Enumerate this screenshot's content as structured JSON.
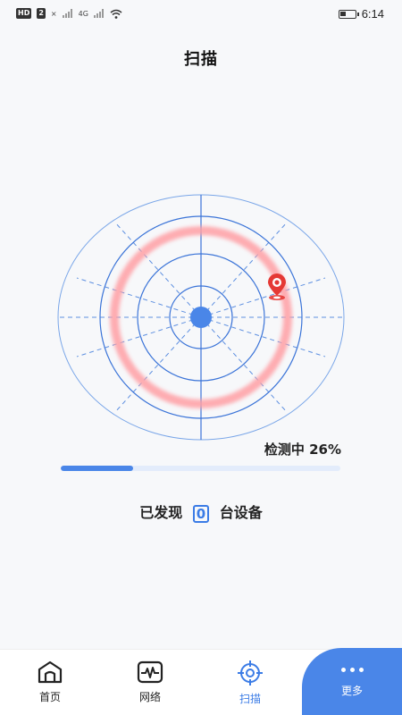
{
  "status_bar": {
    "left_badges": [
      "HD",
      "2"
    ],
    "signal_labels": [
      "×",
      "4G"
    ],
    "time": "6:14"
  },
  "page": {
    "title": "扫描"
  },
  "scan": {
    "status_text": "检测中  26%",
    "progress": 0.26,
    "found_prefix": "已发现",
    "found_count": "0",
    "found_suffix": "台设备"
  },
  "nav": {
    "items": [
      {
        "label": "首页",
        "icon": "home-icon"
      },
      {
        "label": "网络",
        "icon": "pulse-icon"
      },
      {
        "label": "扫描",
        "icon": "crosshair-icon"
      },
      {
        "label": "更多",
        "icon": "more-dots-icon"
      }
    ],
    "active_index": 2
  },
  "colors": {
    "accent": "#4a86e8",
    "ring": "#ff9fa4",
    "marker": "#e53935"
  }
}
